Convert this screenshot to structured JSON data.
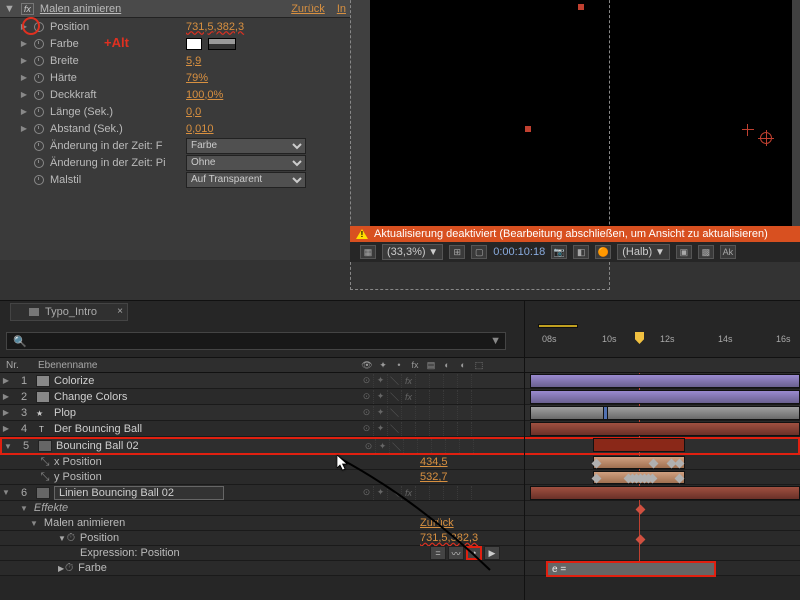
{
  "effect": {
    "fx_label": "fx",
    "name": "Malen animieren",
    "reset": "Zurück",
    "in": "In",
    "alt_overlay": "+Alt"
  },
  "props": [
    {
      "label": "Position",
      "value": "731,5,382,3",
      "type": "link",
      "circled": true
    },
    {
      "label": "Farbe",
      "type": "color"
    },
    {
      "label": "Breite",
      "value": "5,9",
      "type": "link"
    },
    {
      "label": "Härte",
      "value": "79%",
      "type": "link"
    },
    {
      "label": "Deckkraft",
      "value": "100,0%",
      "type": "link"
    },
    {
      "label": "Länge (Sek.)",
      "value": "0,0",
      "type": "link"
    },
    {
      "label": "Abstand (Sek.)",
      "value": "0,010",
      "type": "link"
    },
    {
      "label": "Änderung in der Zeit: F",
      "value": "Farbe",
      "type": "select"
    },
    {
      "label": "Änderung in der Zeit: Pi",
      "value": "Ohne",
      "type": "select"
    },
    {
      "label": "Malstil",
      "value": "Auf Transparent",
      "type": "select"
    }
  ],
  "preview": {
    "warning": "Aktualisierung deaktiviert (Bearbeitung abschließen, um Ansicht zu aktualisieren)",
    "zoom": "(33,3%)",
    "timecode": "0:00:10:18",
    "quality": "(Halb)"
  },
  "timeline": {
    "comp_name": "Typo_Intro",
    "search_glyph": "🔍",
    "ticks": [
      "08s",
      "10s",
      "12s",
      "14s",
      "16s"
    ],
    "col_nr": "Nr.",
    "col_name": "Ebenenname"
  },
  "layers": [
    {
      "idx": "1",
      "name": "Colorize",
      "fx": true
    },
    {
      "idx": "2",
      "name": "Change Colors",
      "fx": true
    },
    {
      "idx": "3",
      "name": "Plop",
      "icon": "star"
    },
    {
      "idx": "4",
      "name": "Der Bouncing Ball",
      "icon": "text"
    },
    {
      "idx": "5",
      "name": "Bouncing Ball 02",
      "icon": "solid2",
      "selected": true
    },
    {
      "idx": "6",
      "name": "Linien Bouncing Ball 02",
      "icon": "solid2",
      "boxed": true,
      "fx": true
    }
  ],
  "layer5_props": {
    "x_label": "x Position",
    "x_value": "434,5",
    "y_label": "y Position",
    "y_value": "532,7"
  },
  "layer6_effects": {
    "section": "Effekte",
    "effect_name": "Malen animieren",
    "reset": "Zurück",
    "pos_label": "Position",
    "pos_value": "731,5,382,3",
    "expr_label": "Expression: Position",
    "expr_value": "e = ",
    "farbe_label": "Farbe",
    "expr_buttons": [
      "=",
      "〰",
      "◔",
      "▶"
    ]
  }
}
